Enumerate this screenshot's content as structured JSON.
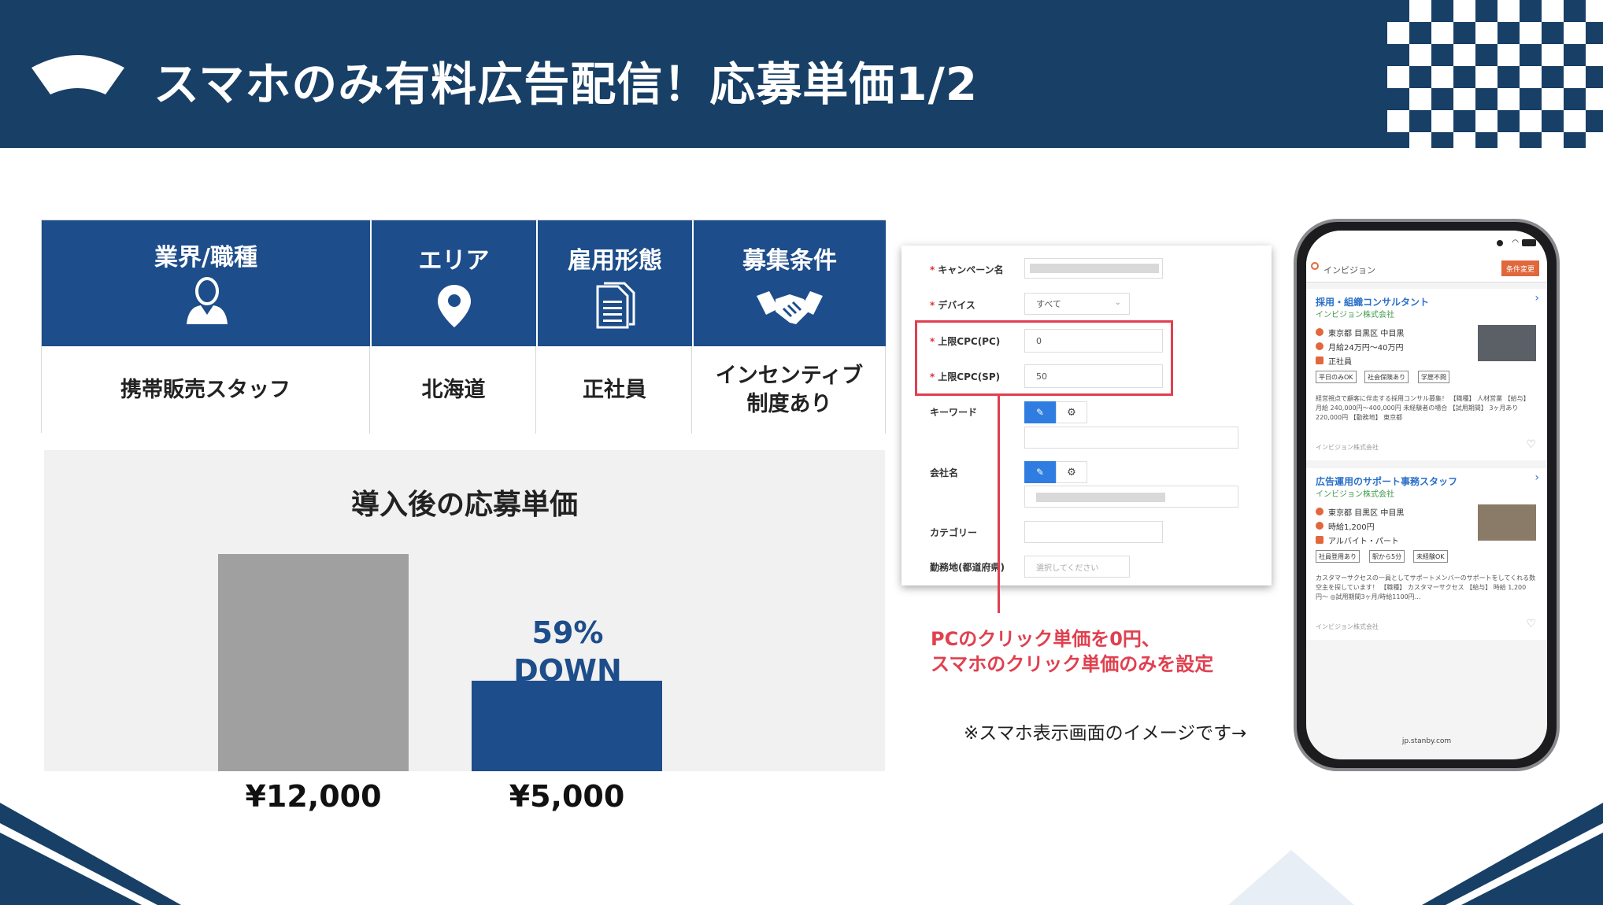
{
  "slide": {
    "title": "スマホのみ有料広告配信！応募単価1/2",
    "colors": {
      "navy": "#183f66",
      "blue": "#1d4d8a",
      "gray_bar": "#a0a0a0",
      "red": "#e0404f"
    }
  },
  "table": {
    "columns": [
      {
        "header": "業界/職種",
        "icon": "person-icon",
        "value": "携帯販売スタッフ"
      },
      {
        "header": "エリア",
        "icon": "location-pin-icon",
        "value": "北海道"
      },
      {
        "header": "雇用形態",
        "icon": "document-icon",
        "value": "正社員"
      },
      {
        "header": "募集条件",
        "icon": "handshake-icon",
        "value_line1": "インセンティブ",
        "value_line2": "制度あり"
      }
    ]
  },
  "chart_data": {
    "type": "bar",
    "title": "導入後の応募単価",
    "categories": [
      "¥12,000",
      "¥5,000"
    ],
    "values": [
      12000,
      5000
    ],
    "colors": [
      "#a0a0a0",
      "#1d4d8a"
    ],
    "annotation_line1": "59%",
    "annotation_line2": "DOWN"
  },
  "form": {
    "rows": {
      "campaign_label": "キャンペーン名",
      "device_label": "デバイス",
      "device_value": "すべて",
      "cpc_pc_label": "上限CPC(PC)",
      "cpc_pc_value": "0",
      "cpc_sp_label": "上限CPC(SP)",
      "cpc_sp_value": "50",
      "keyword_label": "キーワード",
      "company_label": "会社名",
      "category_label": "カテゴリー",
      "location_label": "勤務地(都道府県)",
      "location_placeholder": "選択してください"
    },
    "callout_line1": "PCのクリック単価を0円、",
    "callout_line2": "スマホのクリック単価のみを設定",
    "note": "※スマホ表示画面のイメージです→"
  },
  "phone": {
    "search_query": "インビジョン",
    "filter_button": "条件変更",
    "url": "jp.stanby.com",
    "jobs": [
      {
        "title": "採用・組織コンサルタント",
        "company": "インビジョン株式会社",
        "location": "東京都 目黒区 中目黒",
        "salary": "月給24万円〜40万円",
        "employment": "正社員",
        "tags": [
          "平日のみOK",
          "社会保険あり",
          "学歴不問"
        ],
        "description": "経営視点で顧客に伴走する採用コンサル募集！ 【職種】 人材営業 【給与】 月給 240,000円〜400,000円 未経験者の場合 【試用期間】 3ヶ月あり 220,000円 【勤務地】 東京都",
        "footer_company": "インビジョン株式会社"
      },
      {
        "title": "広告運用のサポート事務スタッフ",
        "company": "インビジョン株式会社",
        "location": "東京都 目黒区 中目黒",
        "salary": "時給1,200円",
        "employment": "アルバイト・パート",
        "tags": [
          "社員登用あり",
          "駅から5分",
          "未経験OK"
        ],
        "description": "カスタマーサクセスの一員としてサポートメンバーのサポートをしてくれる数空主を探しています！ 【職種】 カスタマーサクセス 【給与】 時給 1,200円〜 ◎試用期間3ヶ月/時給1100円…",
        "footer_company": "インビジョン株式会社"
      }
    ]
  }
}
